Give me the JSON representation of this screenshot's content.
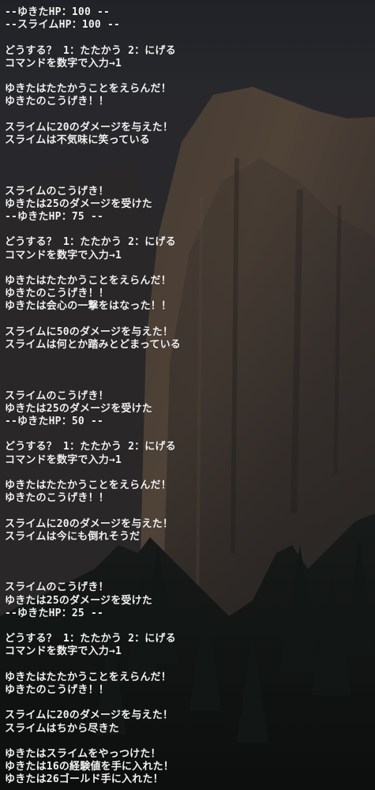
{
  "terminal": {
    "lines": [
      "--ゆきたHP：100 --",
      "--スライムHP：100 --",
      "",
      "どうする？ 1：たたかう 2：にげる",
      "コマンドを数字で入力→1",
      "",
      "ゆきたはたたかうことをえらんだ！",
      "ゆきたのこうげき！！",
      "",
      "スライムに20のダメージを与えた！",
      "スライムは不気味に笑っている",
      "",
      "",
      "",
      "スライムのこうげき！",
      "ゆきたは25のダメージを受けた",
      "--ゆきたHP：75 --",
      "",
      "どうする？ 1：たたかう 2：にげる",
      "コマンドを数字で入力→1",
      "",
      "ゆきたはたたかうことをえらんだ！",
      "ゆきたのこうげき！！",
      "ゆきたは会心の一撃をはなった！！",
      "",
      "スライムに50のダメージを与えた！",
      "スライムは何とか踏みとどまっている",
      "",
      "",
      "",
      "スライムのこうげき！",
      "ゆきたは25のダメージを受けた",
      "--ゆきたHP：50 --",
      "",
      "どうする？ 1：たたかう 2：にげる",
      "コマンドを数字で入力→1",
      "",
      "ゆきたはたたかうことをえらんだ！",
      "ゆきたのこうげき！！",
      "",
      "スライムに20のダメージを与えた！",
      "スライムは今にも倒れそうだ",
      "",
      "",
      "",
      "スライムのこうげき！",
      "ゆきたは25のダメージを受けた",
      "--ゆきたHP：25 --",
      "",
      "どうする？ 1：たたかう 2：にげる",
      "コマンドを数字で入力→1",
      "",
      "ゆきたはたたかうことをえらんだ！",
      "ゆきたのこうげき！！",
      "",
      "スライムに20のダメージを与えた！",
      "スライムはちから尽きた",
      "",
      "ゆきたはスライムをやっつけた！",
      "ゆきたは16の経験値を手に入れた！",
      "ゆきたは26ゴールド手に入れた！"
    ]
  },
  "colors": {
    "text": "#f2f2f2",
    "background": "#2b2d31"
  }
}
